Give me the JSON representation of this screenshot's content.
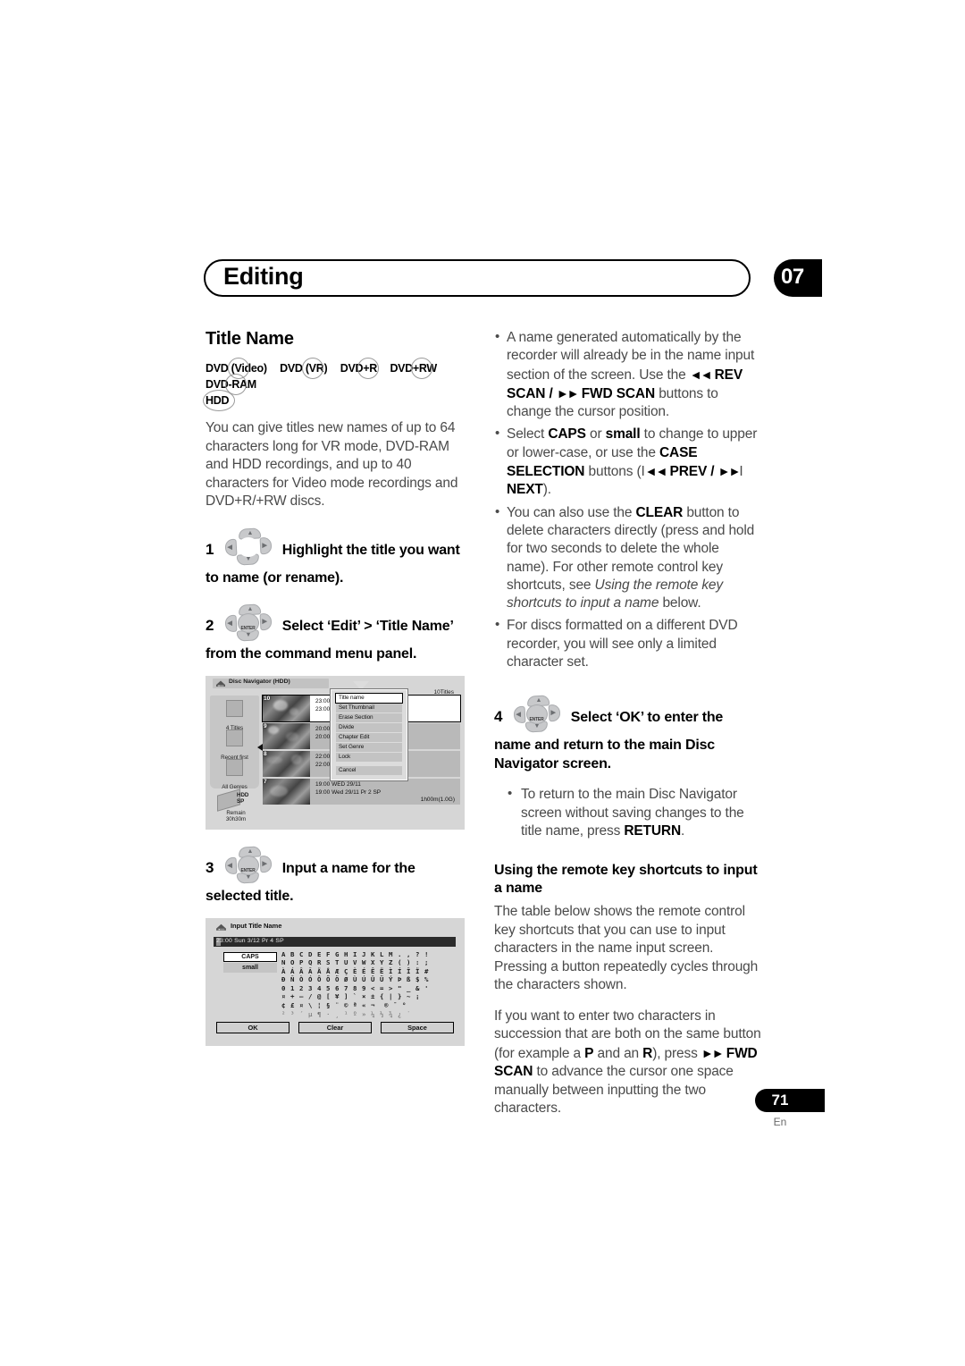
{
  "header": {
    "title": "Editing",
    "chapter": "07"
  },
  "left": {
    "section_title": "Title Name",
    "badges": [
      {
        "label": "DVD (Video)",
        "name": "dvd-video"
      },
      {
        "label": "DVD (VR)",
        "name": "dvd-vr"
      },
      {
        "label": "DVD+R",
        "name": "dvd-plus-r"
      },
      {
        "label": "DVD+RW",
        "name": "dvd-plus-rw"
      },
      {
        "label": "DVD-RAM",
        "name": "dvd-ram"
      }
    ],
    "badge_hdd": "HDD",
    "intro": "You can give titles new names of up to 64 characters long for VR mode, DVD-RAM and HDD recordings, and up to 40 characters for Video mode recordings and DVD+R/+RW discs.",
    "step1": {
      "num": "1",
      "text": "Highlight the title you want to name (or rename)."
    },
    "step2": {
      "num": "2",
      "text": "Select ‘Edit’ > ‘Title Name’ from the command menu panel."
    },
    "step3": {
      "num": "3",
      "text": "Input a name for the selected title."
    }
  },
  "nav_screen": {
    "title": "Disc Navigator (HDD)",
    "title_count": "10Titles",
    "sidebar": [
      {
        "label": "4 Titles"
      },
      {
        "label": "Recent first"
      },
      {
        "label": "All Genres"
      }
    ],
    "disc_label_1": "HDD",
    "disc_label_2": "SP",
    "remain_label": "Remain",
    "remain_value": "30h30m",
    "rows": [
      {
        "num": "10",
        "line1": "23:00 SUN  3/12",
        "line2": "23:00  Sun  3/12  Pr",
        "line3": "",
        "selected": true
      },
      {
        "num": "9",
        "line1": "20:00 SUN  3/12",
        "line2": "20:00  Sun  3/12  Pr",
        "line3": "",
        "selected": false
      },
      {
        "num": "8",
        "line1": "22:00 SAT  2/12",
        "line2": "22:00  Sat  2/12  Pr",
        "line3": "",
        "selected": false
      },
      {
        "num": "7",
        "line1": "19:00  WED  29/11",
        "line2": "19:00  Wed  29/11  Pr 2  SP",
        "line3": "1h00m(1.0G)",
        "selected": false
      }
    ],
    "menu": [
      {
        "label": "Title name",
        "active": true
      },
      {
        "label": "Set Thumbnail",
        "active": false
      },
      {
        "label": "Erase Section",
        "active": false
      },
      {
        "label": "Divide",
        "active": false
      },
      {
        "label": "Chapter Edit",
        "active": false
      },
      {
        "label": "Set Genre",
        "active": false
      },
      {
        "label": "Lock",
        "active": false
      }
    ],
    "menu_cancel": "Cancel"
  },
  "input_screen": {
    "title": "Input Title Name",
    "name_value": "23:00  Sun  3/12  Pr 4   SP",
    "case_caps": "CAPS",
    "case_small": "small",
    "charmap": [
      "A B C D E F G H I  J K L M . , ? !",
      "N O P Q R S T U V W X Y Z ( ) : ;",
      "À Á Â Ã Ä Å Æ Ç È É Ê Ë Ì Í Î Ï #",
      "Ð Ñ Ò Ó Ô Õ Ö Ø Ù Ú Û Ü Ý Þ ß $ %",
      "0 1 2 3 4 5 6 7 8 9 < = > \" _ & '",
      "¤ + – / @ [ ¥ ]  ` × ± { | } ~ ¡",
      "¢ £ ¤ \\ ¦ § ¨ © ª « ¬ ­ ® ¯ °",
      "² ³ ´ µ ¶ · ¸ ¹ º » ¼ ½ ¾ ¿ ˙"
    ],
    "buttons": {
      "ok": "OK",
      "clear": "Clear",
      "space": "Space"
    }
  },
  "right": {
    "bullets_top": [
      "A name generated automatically by the recorder will already be in the name input section of the screen. Use the ◄◄ REV SCAN / ►► FWD SCAN buttons to change the cursor position.",
      "Select CAPS or small to change to upper or lower-case, or use the CASE SELECTION buttons (I◄◄ PREV / ►►I NEXT).",
      "You can also use the CLEAR button to delete characters directly (press and hold for two seconds to delete the whole name). For other remote control key shortcuts, see Using the remote key shortcuts to input a name below.",
      "For discs formatted on a different DVD recorder, you will see only a limited character set."
    ],
    "step4": {
      "num": "4",
      "text": "Select ‘OK’ to enter the name and return to the main Disc Navigator screen."
    },
    "step4_bullet": "To return to the main Disc Navigator screen without saving changes to the title name, press RETURN.",
    "subhead": "Using the remote key shortcuts to input a name",
    "para1": "The table below shows the remote control key shortcuts that you can use to input characters in the name input screen. Pressing a button repeatedly cycles through the characters shown.",
    "para2": "If you want to enter two characters in succession that are both on the same button (for example a P and an R), press ►► FWD SCAN to advance the cursor one space manually between inputting the two characters."
  },
  "footer": {
    "page_number": "71",
    "language": "En"
  }
}
